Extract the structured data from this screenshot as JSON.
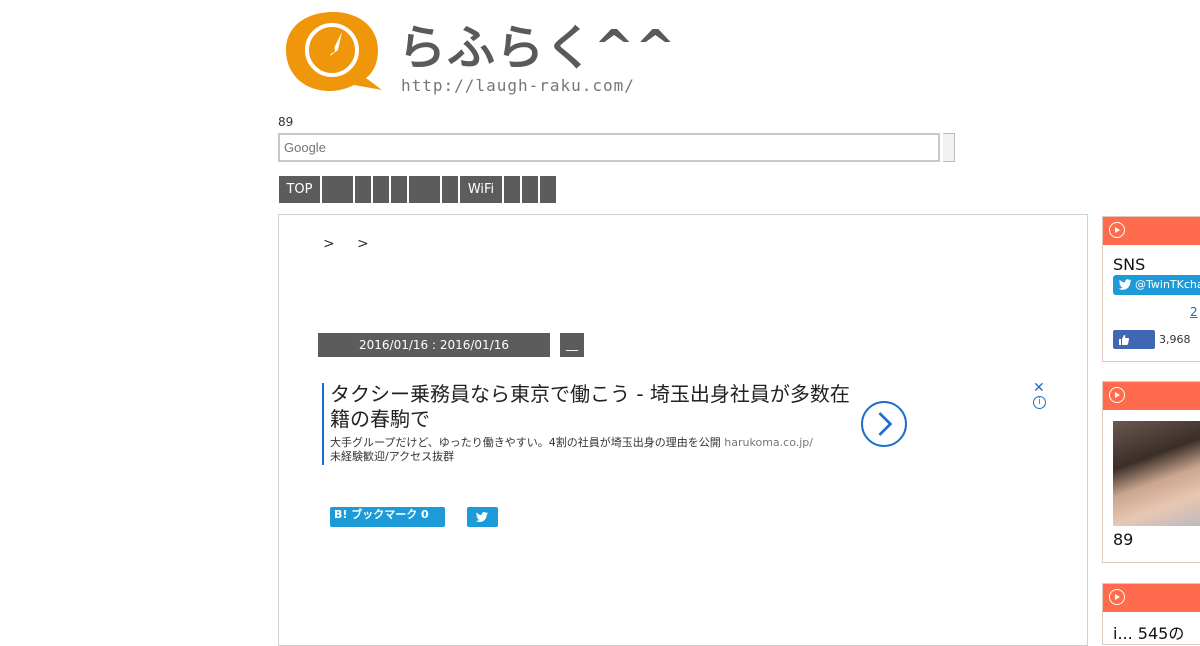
{
  "header": {
    "logo_text": "らふらく^^",
    "logo_url": "http://laugh-raku.com/",
    "count_label": "89"
  },
  "search": {
    "placeholder": "Google"
  },
  "nav": {
    "items": [
      "TOP",
      "",
      "",
      "",
      "",
      "",
      "",
      "WiFi",
      "",
      "",
      ""
    ]
  },
  "breadcrumb": {
    "sep1": ">",
    "sep2": ">"
  },
  "post": {
    "dates": "2016/01/16 : 2016/01/16",
    "category": "__"
  },
  "ad": {
    "title": "タクシー乗務員なら東京で働こう - 埼玉出身社員が多数在籍の春駒で",
    "description": "大手グループだけど、ゆったり働きやすい。4割の社員が埼玉出身の理由を公開 ",
    "domain": "harukoma.co.jp/",
    "description2": "未経験歓迎/アクセス抜群",
    "close": "✕",
    "info": "i"
  },
  "share": {
    "hatena_label": "B! ブックマーク 0"
  },
  "sidebar": {
    "sns_title": "SNS",
    "twitter_handle": "@TwinTKchan",
    "follow_count": "2",
    "fb_count": "3,968",
    "profile_num": "89",
    "w3_text": "i... 545の"
  },
  "colors": {
    "logo_orange": "#f0960a",
    "nav_gray": "#5c5c5c",
    "widget_header": "#ff6b4d",
    "twitter_blue": "#1d9bd8",
    "ad_blue": "#1e6fc9"
  }
}
